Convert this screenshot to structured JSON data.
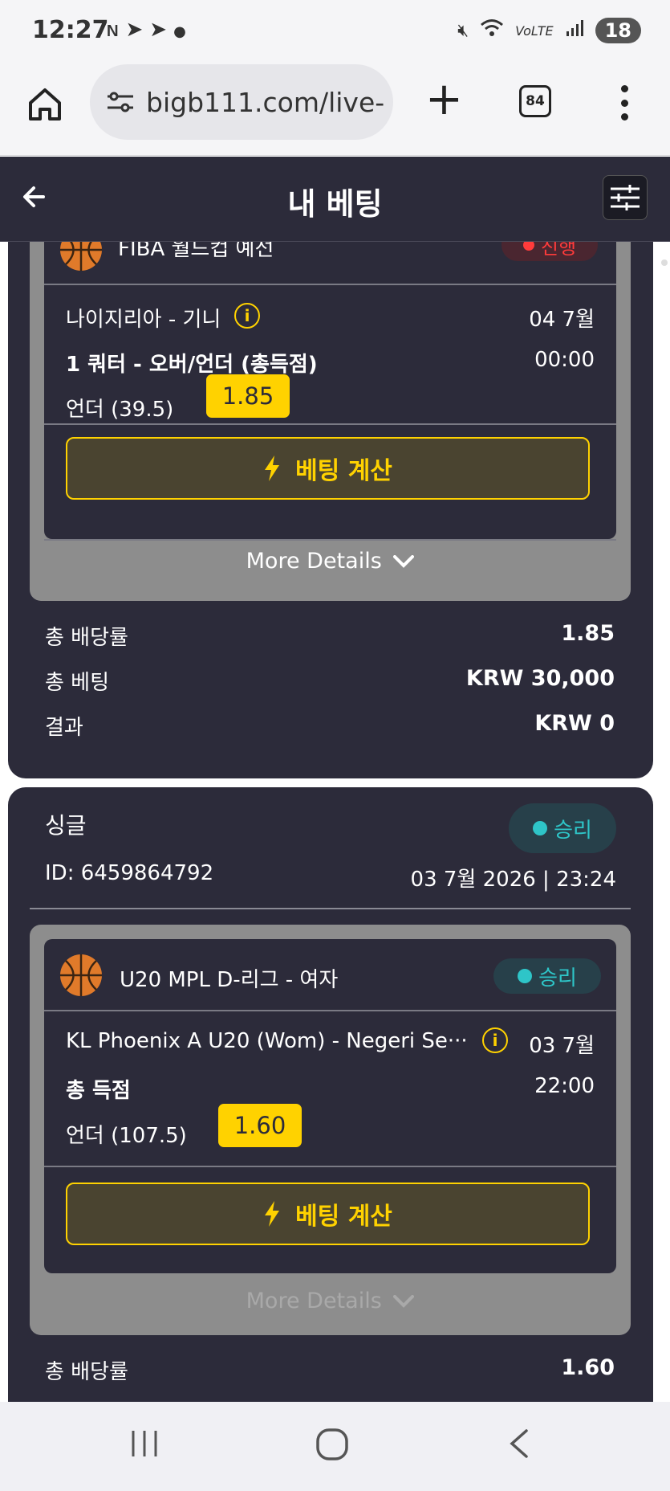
{
  "status_bar": {
    "time": "12:27",
    "left_icons": [
      "n-icon",
      "telegram-icon",
      "telegram-icon",
      "dot-icon"
    ],
    "right_icons": [
      "mute-icon",
      "wifi-icon",
      "volte-icon",
      "signal-icon"
    ],
    "battery": "18"
  },
  "browser": {
    "url": "bigb111.com/live-",
    "tab_count": "84"
  },
  "header": {
    "title": "내 베팅"
  },
  "card1": {
    "league_partial": "FIBA 월드컵 예선",
    "status_partial": "진행",
    "match": "나이지리아 - 기니",
    "date": "04 7월",
    "market": "1 쿼터 - 오버/언더 (총득점)",
    "time": "00:00",
    "selection": "언더 (39.5)",
    "odds": "1.85",
    "calc_label": "베팅 계산",
    "more_details": "More Details",
    "summary": [
      {
        "label": "총 배당률",
        "value": "1.85"
      },
      {
        "label": "총 베팅",
        "value": "KRW 30,000"
      },
      {
        "label": "결과",
        "value": "KRW 0"
      }
    ]
  },
  "card2": {
    "type": "싱글",
    "status": "승리",
    "id_text": "ID: 6459864792",
    "datetime": "03 7월 2026 | 23:24",
    "league": "U20 MPL D-리그 - 여자",
    "league_status": "승리",
    "match": "KL Phoenix A U20 (Wom) - Negeri Se···",
    "date": "03 7월",
    "market": "총 득점",
    "time": "22:00",
    "selection": "언더 (107.5)",
    "odds": "1.60",
    "calc_label": "베팅 계산",
    "more_details": "More Details",
    "summary": [
      {
        "label": "총 배당률",
        "value": "1.60"
      }
    ]
  },
  "colors": {
    "card_bg": "#2c2b3a",
    "accent_yellow": "#ffd200",
    "win_teal": "#2ec5c8",
    "inner_gray": "#8d8d8d"
  }
}
